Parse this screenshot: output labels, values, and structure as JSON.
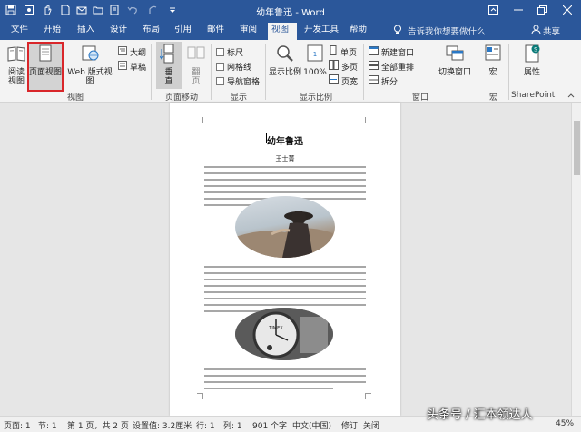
{
  "titlebar": {
    "title": "幼年鲁迅 - Word",
    "colors": {
      "brand": "#2b579a"
    }
  },
  "tabs": [
    {
      "label": "文件"
    },
    {
      "label": "开始"
    },
    {
      "label": "插入"
    },
    {
      "label": "设计"
    },
    {
      "label": "布局"
    },
    {
      "label": "引用"
    },
    {
      "label": "邮件"
    },
    {
      "label": "审阅"
    },
    {
      "label": "视图",
      "active": true
    },
    {
      "label": "开发工具"
    },
    {
      "label": "帮助"
    }
  ],
  "tell_me": "告诉我你想要做什么",
  "share": "共享",
  "ribbon": {
    "views": {
      "read_mode": "阅读视图",
      "print_layout": "页面视图",
      "web_layout": "Web 版式视图",
      "outline": "大纲",
      "draft": "草稿",
      "group_label": "视图"
    },
    "page_movement": {
      "vertical": "垂直",
      "side_to_side": "翻页",
      "group_label": "页面移动"
    },
    "show": {
      "ruler": "标尺",
      "gridlines": "网格线",
      "nav_pane": "导航窗格",
      "group_label": "显示"
    },
    "zoom": {
      "zoom": "显示比例",
      "hundred": "100%",
      "one_page": "单页",
      "multi_page": "多页",
      "page_width": "页宽",
      "group_label": "显示比例"
    },
    "window": {
      "new_window": "新建窗口",
      "arrange_all": "全部重排",
      "split": "拆分",
      "switch_windows": "切换窗口",
      "group_label": "窗口"
    },
    "macros": {
      "label": "宏",
      "group_label": "宏"
    },
    "sharepoint": {
      "label": "属性",
      "group_label": "SharePoint"
    }
  },
  "document": {
    "title": "幼年鲁迅",
    "author": "王士菁"
  },
  "statusbar": {
    "section": "页面: 1",
    "sect": "节: 1",
    "page_of": "第 1 页，共 2 页",
    "position": "设置值: 3.2厘米",
    "line": "行: 1",
    "column": "列: 1",
    "words": "901 个字",
    "language": "中文(中国)",
    "track": "修订: 关闭",
    "zoom": "45%"
  },
  "watermark": "头条号 / 汇本领达人"
}
